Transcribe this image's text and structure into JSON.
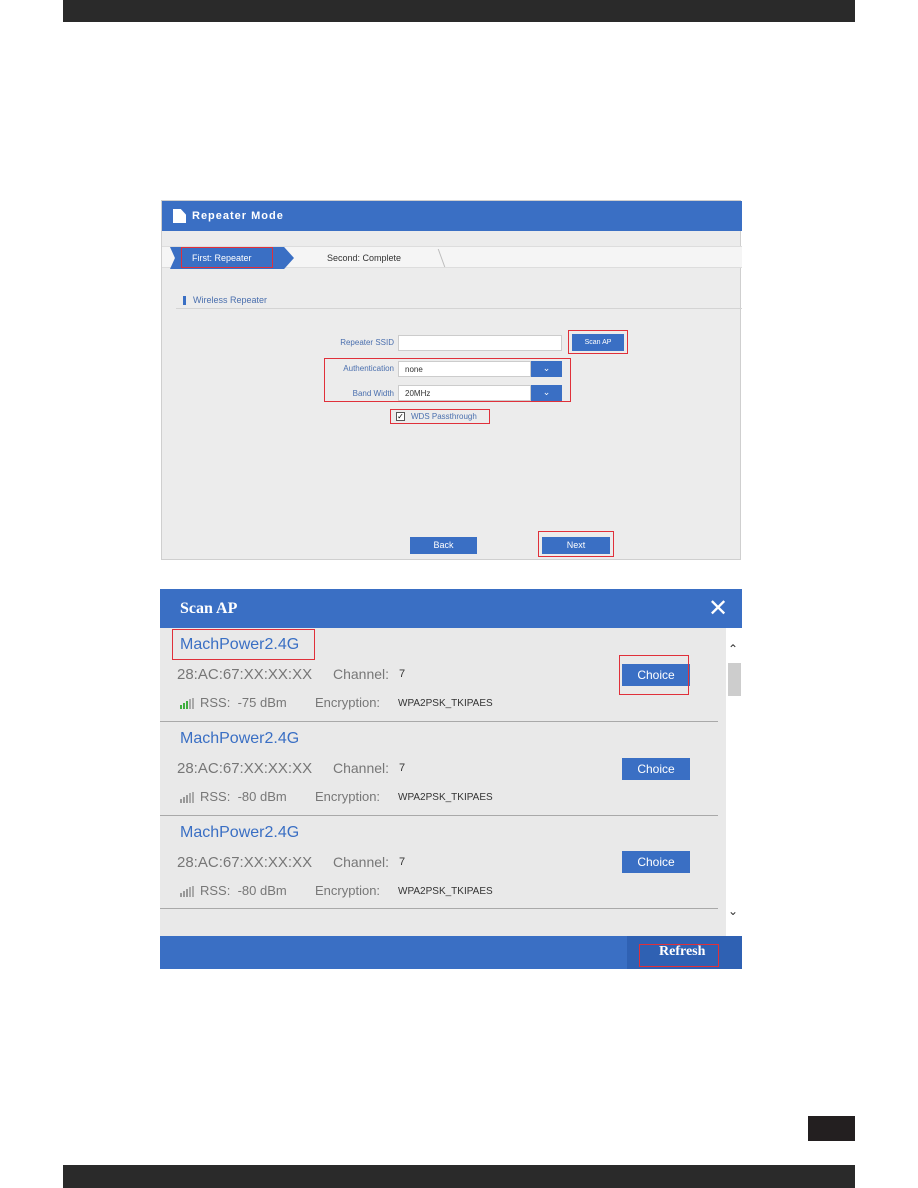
{
  "repeater_mode": {
    "title": "Repeater Mode",
    "steps": [
      "First: Repeater",
      "Second: Complete"
    ],
    "section": "Wireless Repeater",
    "fields": {
      "ssid_label": "Repeater SSID",
      "ssid_value": "",
      "scan_button": "Scan AP",
      "auth_label": "Authentication",
      "auth_value": "none",
      "band_label": "Band Width",
      "band_value": "20MHz",
      "wds_label": "WDS Passthrough",
      "wds_checked": true
    },
    "back_button": "Back",
    "next_button": "Next",
    "highlight_color": "#e0303a",
    "accent": "#3a6fc4"
  },
  "scan_ap": {
    "title": "Scan AP",
    "close_icon": "close-icon",
    "labels": {
      "channel": "Channel:",
      "rss": "RSS:",
      "encryption": "Encryption:"
    },
    "items": [
      {
        "ssid": "MachPower2.4G",
        "mac": "28:AC:67:XX:XX:XX",
        "channel": "7",
        "rss": "-75 dBm",
        "encryption": "WPA2PSK_TKIPAES",
        "choice": "Choice",
        "signal_color": "#3fae3f"
      },
      {
        "ssid": "MachPower2.4G",
        "mac": "28:AC:67:XX:XX:XX",
        "channel": "7",
        "rss": "-80 dBm",
        "encryption": "WPA2PSK_TKIPAES",
        "choice": "Choice",
        "signal_color": "#999999"
      },
      {
        "ssid": "MachPower2.4G",
        "mac": "28:AC:67:XX:XX:XX",
        "channel": "7",
        "rss": "-80 dBm",
        "encryption": "WPA2PSK_TKIPAES",
        "choice": "Choice",
        "signal_color": "#999999"
      }
    ],
    "refresh_button": "Refresh"
  }
}
